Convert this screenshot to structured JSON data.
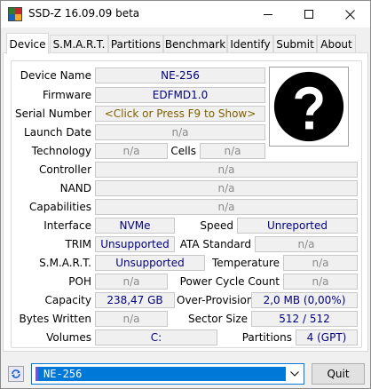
{
  "window": {
    "title": "SSD-Z 16.09.09 beta"
  },
  "tabs": [
    {
      "label": "Device",
      "active": true
    },
    {
      "label": "S.M.A.R.T.",
      "active": false
    },
    {
      "label": "Partitions",
      "active": false
    },
    {
      "label": "Benchmark",
      "active": false
    },
    {
      "label": "Identify",
      "active": false
    },
    {
      "label": "Submit",
      "active": false
    },
    {
      "label": "About",
      "active": false
    }
  ],
  "device": {
    "device_name": {
      "label": "Device Name",
      "value": "NE-256"
    },
    "firmware": {
      "label": "Firmware",
      "value": "EDFMD1.0"
    },
    "serial_number": {
      "label": "Serial Number",
      "value": "<Click or Press F9 to Show>"
    },
    "launch_date": {
      "label": "Launch Date",
      "value": "n/a"
    },
    "technology": {
      "label": "Technology",
      "value": "n/a"
    },
    "cells": {
      "label": "Cells",
      "value": "n/a"
    },
    "controller": {
      "label": "Controller",
      "value": "n/a"
    },
    "nand": {
      "label": "NAND",
      "value": "n/a"
    },
    "capabilities": {
      "label": "Capabilities",
      "value": "n/a"
    },
    "interface": {
      "label": "Interface",
      "value": "NVMe"
    },
    "speed": {
      "label": "Speed",
      "value": "Unreported"
    },
    "trim": {
      "label": "TRIM",
      "value": "Unsupported"
    },
    "ata_standard": {
      "label": "ATA Standard",
      "value": "n/a"
    },
    "smart": {
      "label": "S.M.A.R.T.",
      "value": "Unsupported"
    },
    "temperature": {
      "label": "Temperature",
      "value": "n/a"
    },
    "poh": {
      "label": "POH",
      "value": "n/a"
    },
    "power_cycle_count": {
      "label": "Power Cycle Count",
      "value": "n/a"
    },
    "capacity": {
      "label": "Capacity",
      "value": "238,47 GB"
    },
    "over_provision": {
      "label": "Over-Provision",
      "value": "2,0 MB (0,00%)"
    },
    "bytes_written": {
      "label": "Bytes Written",
      "value": "n/a"
    },
    "sector_size": {
      "label": "Sector Size",
      "value": "512 / 512"
    },
    "volumes": {
      "label": "Volumes",
      "value": "C:"
    },
    "partitions": {
      "label": "Partitions",
      "value": "4 (GPT)"
    },
    "image_icon": "question-mark-icon"
  },
  "statusbar": {
    "drive_selected": "NE-256",
    "quit_label": "Quit"
  }
}
